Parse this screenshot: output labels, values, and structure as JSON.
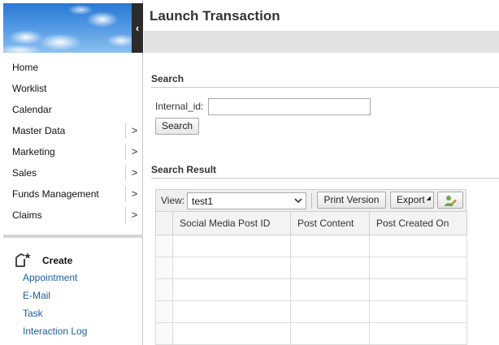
{
  "nav": {
    "items": [
      {
        "label": "Home",
        "has_submenu": false
      },
      {
        "label": "Worklist",
        "has_submenu": false
      },
      {
        "label": "Calendar",
        "has_submenu": false
      },
      {
        "label": "Master Data",
        "has_submenu": true
      },
      {
        "label": "Marketing",
        "has_submenu": true
      },
      {
        "label": "Sales",
        "has_submenu": true
      },
      {
        "label": "Funds Management",
        "has_submenu": true
      },
      {
        "label": "Claims",
        "has_submenu": true
      }
    ],
    "submenu_arrow": ">",
    "collapse_arrow": "‹",
    "create": {
      "title": "Create",
      "icon": "create-new-icon",
      "links": [
        "Appointment",
        "E-Mail",
        "Task",
        "Interaction Log"
      ]
    }
  },
  "header": {
    "title": "Launch Transaction"
  },
  "search": {
    "section_title": "Search",
    "field_label": "Internal_id:",
    "field_value": "",
    "field_placeholder": "",
    "button_label": "Search"
  },
  "results": {
    "section_title": "Search Result",
    "toolbar": {
      "view_label": "View:",
      "view_value": "test1",
      "print_label": "Print Version",
      "export_label": "Export",
      "personalize_icon": "personalize-icon"
    },
    "columns": [
      "Social Media Post ID",
      "Post Content",
      "Post Created On"
    ],
    "empty_row_count": 5
  },
  "colors": {
    "link": "#1a5e9e",
    "band": "#e2e2e2",
    "collapse_bar": "#2b2b2b"
  }
}
